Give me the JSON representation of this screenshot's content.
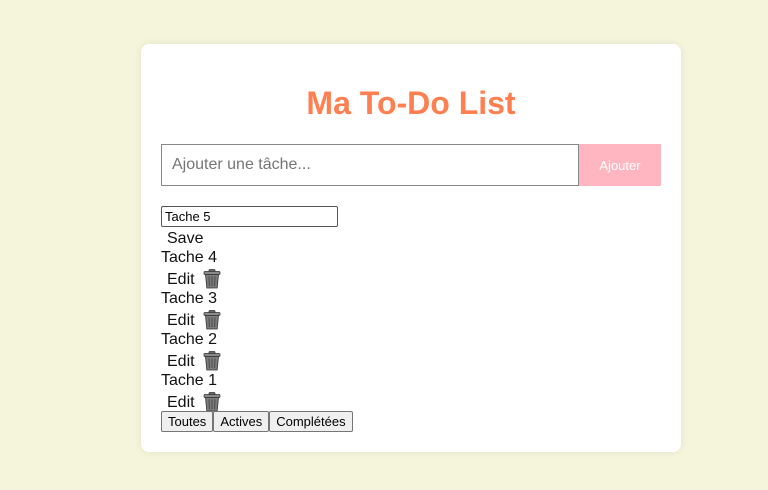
{
  "header": {
    "title": "Ma To-Do List"
  },
  "add_form": {
    "placeholder": "Ajouter une tâche...",
    "button_label": "Ajouter"
  },
  "editing_item": {
    "value": "Tache 5",
    "save_label": "Save"
  },
  "todos": [
    {
      "label": "Tache 4",
      "edit_label": "Edit",
      "delete_icon": "trash-icon"
    },
    {
      "label": "Tache 3",
      "edit_label": "Edit",
      "delete_icon": "trash-icon"
    },
    {
      "label": "Tache 2",
      "edit_label": "Edit",
      "delete_icon": "trash-icon"
    },
    {
      "label": "Tache 1",
      "edit_label": "Edit",
      "delete_icon": "trash-icon"
    }
  ],
  "filters": [
    {
      "label": "Toutes"
    },
    {
      "label": "Actives"
    },
    {
      "label": "Complétées"
    }
  ],
  "colors": {
    "page_background": "#f5f5dc",
    "title": "#ff7f50",
    "add_button": "#ffb6c1"
  }
}
